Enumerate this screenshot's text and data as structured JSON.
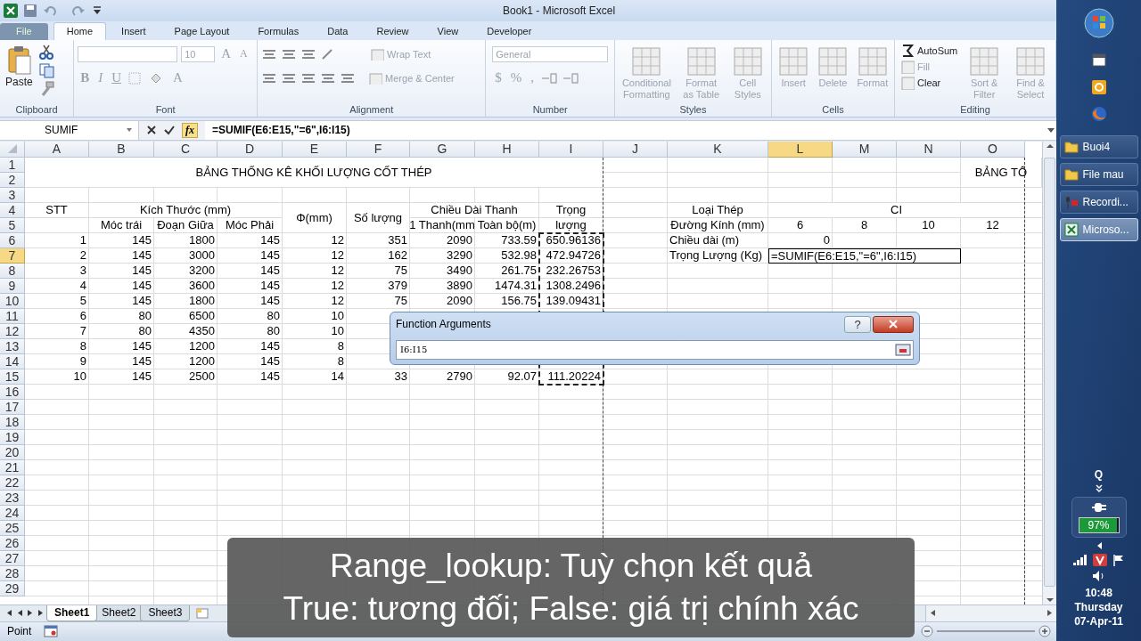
{
  "window": {
    "title": "Book1  -  Microsoft Excel"
  },
  "ribbon_tabs": [
    {
      "label": "File",
      "kind": "file",
      "selected": false
    },
    {
      "label": "Home",
      "kind": "tab",
      "selected": true
    },
    {
      "label": "Insert",
      "kind": "tab",
      "selected": false
    },
    {
      "label": "Page Layout",
      "kind": "tab",
      "selected": false
    },
    {
      "label": "Formulas",
      "kind": "tab",
      "selected": false
    },
    {
      "label": "Data",
      "kind": "tab",
      "selected": false
    },
    {
      "label": "Review",
      "kind": "tab",
      "selected": false
    },
    {
      "label": "View",
      "kind": "tab",
      "selected": false
    },
    {
      "label": "Developer",
      "kind": "tab",
      "selected": false
    }
  ],
  "ribbon_groups": [
    {
      "name": "Clipboard",
      "kind": "clipboard",
      "items": [
        {
          "label": "Paste",
          "disabled": false
        }
      ]
    },
    {
      "name": "Font",
      "kind": "font",
      "items": [
        {
          "label": "10",
          "disabled": true
        },
        {
          "label": "A",
          "disabled": true
        },
        {
          "label": "A",
          "disabled": true
        },
        {
          "label": "B",
          "disabled": true
        },
        {
          "label": "I",
          "disabled": true
        },
        {
          "label": "U",
          "disabled": true
        },
        {
          "label": "A",
          "disabled": true
        }
      ]
    },
    {
      "name": "Alignment",
      "kind": "alignment",
      "items": [
        {
          "label": "Wrap Text",
          "disabled": true
        },
        {
          "label": "Merge & Center",
          "disabled": true
        }
      ]
    },
    {
      "name": "Number",
      "kind": "number",
      "items": [
        {
          "label": "General",
          "disabled": true
        },
        {
          "label": "$",
          "disabled": true
        },
        {
          "label": "%",
          "disabled": true
        },
        {
          "label": ",",
          "disabled": true
        }
      ]
    },
    {
      "name": "Styles",
      "kind": "large",
      "items": [
        {
          "label": "Conditional Formatting",
          "disabled": true
        },
        {
          "label": "Format as Table",
          "disabled": true
        },
        {
          "label": "Cell Styles",
          "disabled": true
        }
      ]
    },
    {
      "name": "Cells",
      "kind": "large",
      "items": [
        {
          "label": "Insert",
          "disabled": true
        },
        {
          "label": "Delete",
          "disabled": true
        },
        {
          "label": "Format",
          "disabled": true
        }
      ]
    },
    {
      "name": "Editing",
      "kind": "editing",
      "items": [
        {
          "label": "AutoSum",
          "disabled": false
        },
        {
          "label": "Fill",
          "disabled": true
        },
        {
          "label": "Clear",
          "disabled": false
        },
        {
          "label": "Sort & Filter",
          "disabled": true
        },
        {
          "label": "Find & Select",
          "disabled": true
        }
      ]
    }
  ],
  "formula_bar": {
    "name_box": "SUMIF",
    "fx": "fx",
    "formula": "=SUMIF(E6:E15,\"=6\",I6:I15)"
  },
  "sheet": {
    "columns": [
      {
        "label": "A",
        "selected": false
      },
      {
        "label": "B",
        "selected": false
      },
      {
        "label": "C",
        "selected": false
      },
      {
        "label": "D",
        "selected": false
      },
      {
        "label": "E",
        "selected": false
      },
      {
        "label": "F",
        "selected": false
      },
      {
        "label": "G",
        "selected": false
      },
      {
        "label": "H",
        "selected": false
      },
      {
        "label": "I",
        "selected": false
      },
      {
        "label": "J",
        "selected": false
      },
      {
        "label": "K",
        "selected": false
      },
      {
        "label": "L",
        "selected": true
      },
      {
        "label": "M",
        "selected": false
      },
      {
        "label": "N",
        "selected": false
      },
      {
        "label": "O",
        "selected": false
      }
    ],
    "rows": [
      {
        "label": "1",
        "selected": false
      },
      {
        "label": "2",
        "selected": false
      },
      {
        "label": "3",
        "selected": false
      },
      {
        "label": "4",
        "selected": false
      },
      {
        "label": "5",
        "selected": false
      },
      {
        "label": "6",
        "selected": false
      },
      {
        "label": "7",
        "selected": true
      },
      {
        "label": "8",
        "selected": false
      },
      {
        "label": "9",
        "selected": false
      },
      {
        "label": "10",
        "selected": false
      },
      {
        "label": "11",
        "selected": false
      },
      {
        "label": "12",
        "selected": false
      },
      {
        "label": "13",
        "selected": false
      },
      {
        "label": "14",
        "selected": false
      },
      {
        "label": "15",
        "selected": false
      },
      {
        "label": "16",
        "selected": false
      },
      {
        "label": "17",
        "selected": false
      },
      {
        "label": "18",
        "selected": false
      },
      {
        "label": "19",
        "selected": false
      },
      {
        "label": "20",
        "selected": false
      },
      {
        "label": "21",
        "selected": false
      },
      {
        "label": "22",
        "selected": false
      },
      {
        "label": "23",
        "selected": false
      },
      {
        "label": "24",
        "selected": false
      },
      {
        "label": "25",
        "selected": false
      },
      {
        "label": "26",
        "selected": false
      },
      {
        "label": "27",
        "selected": false
      },
      {
        "label": "28",
        "selected": false
      },
      {
        "label": "29",
        "selected": false
      }
    ],
    "header_rows": [
      {
        "cells": [
          {
            "kind": "heading",
            "text": "BẢNG THỐNG KÊ KHỐI LƯỢNG CỐT THÉP"
          },
          {
            "kind": "heading",
            "text": "BẢNG TỔ"
          }
        ]
      },
      {
        "cells": [
          {
            "kind": "heading",
            "text": "STT"
          },
          {
            "kind": "heading",
            "text": "Kích Thước (mm)"
          },
          {
            "kind": "heading",
            "text": "Φ(mm)"
          },
          {
            "kind": "heading",
            "text": "Số lượng"
          },
          {
            "kind": "heading",
            "text": "Chiều Dài Thanh"
          },
          {
            "kind": "heading",
            "text": "Trọng"
          },
          {
            "kind": "heading",
            "text": "Loại Thép"
          },
          {
            "kind": "heading",
            "text": "CI"
          }
        ]
      },
      {
        "cells": [
          {
            "kind": "heading",
            "text": "Móc trái"
          },
          {
            "kind": "heading",
            "text": "Đoạn Giữa"
          },
          {
            "kind": "heading",
            "text": "Móc Phải"
          },
          {
            "kind": "heading",
            "text": "1 Thanh(mm"
          },
          {
            "kind": "heading",
            "text": "Toàn bộ(m)"
          },
          {
            "kind": "heading",
            "text": "lượng"
          },
          {
            "kind": "heading",
            "text": "Đường Kính (mm)"
          },
          {
            "kind": "heading",
            "text": "6"
          },
          {
            "kind": "heading",
            "text": "8"
          },
          {
            "kind": "heading",
            "text": "10"
          },
          {
            "kind": "heading",
            "text": "12"
          }
        ]
      }
    ],
    "data_rows": [
      {
        "values": [
          "1",
          "145",
          "1800",
          "145",
          "12",
          "351",
          "2090",
          "733.59",
          "650.96136"
        ],
        "side": [
          {
            "kind": "text",
            "text": "Chiều dài (m)"
          },
          {
            "kind": "number",
            "text": "0"
          }
        ]
      },
      {
        "values": [
          "2",
          "145",
          "3000",
          "145",
          "12",
          "162",
          "3290",
          "532.98",
          "472.94726"
        ],
        "side": [
          {
            "kind": "text",
            "text": "Trọng Lượng (Kg)"
          },
          {
            "kind": "editing",
            "text": "=SUMIF(E6:E15,\"=6\",I6:I15)"
          }
        ]
      },
      {
        "values": [
          "3",
          "145",
          "3200",
          "145",
          "12",
          "75",
          "3490",
          "261.75",
          "232.26753"
        ]
      },
      {
        "values": [
          "4",
          "145",
          "3600",
          "145",
          "12",
          "379",
          "3890",
          "1474.31",
          "1308.2496"
        ]
      },
      {
        "values": [
          "5",
          "145",
          "1800",
          "145",
          "12",
          "75",
          "2090",
          "156.75",
          "139.09431"
        ]
      },
      {
        "values": [
          "6",
          "80",
          "6500",
          "80",
          "10"
        ]
      },
      {
        "values": [
          "7",
          "80",
          "4350",
          "80",
          "10"
        ]
      },
      {
        "values": [
          "8",
          "145",
          "1200",
          "145",
          "8"
        ]
      },
      {
        "values": [
          "9",
          "145",
          "1200",
          "145",
          "8"
        ]
      },
      {
        "values": [
          "10",
          "145",
          "2500",
          "145",
          "14",
          "33",
          "2790",
          "92.07",
          "111.20224"
        ]
      }
    ],
    "marquee": true
  },
  "dialog": {
    "title": "Function Arguments",
    "help": "?",
    "value": "I6:I15"
  },
  "sheet_tabs": [
    {
      "label": "Sheet1",
      "selected": true
    },
    {
      "label": "Sheet2",
      "selected": false
    },
    {
      "label": "Sheet3",
      "selected": false
    }
  ],
  "status_bar": {
    "mode": "Point"
  },
  "taskbar": {
    "buttons": [
      {
        "label": "Buoi4",
        "kind": "folder",
        "selected": false
      },
      {
        "label": "File mau",
        "kind": "folder",
        "selected": false
      },
      {
        "label": "Recordi...",
        "kind": "recorder",
        "selected": false
      },
      {
        "label": "Microso...",
        "kind": "excel",
        "selected": true
      }
    ],
    "tray": {
      "q": "Q",
      "battery": {
        "level": 0.97,
        "reading": "97%"
      },
      "time": "10:48",
      "day": "Thursday",
      "date": "07-Apr-11"
    }
  },
  "caption": {
    "lines": [
      "Range_lookup: Tuỳ chọn kết quả",
      "True: tương đối; False: giá trị chính xác"
    ]
  }
}
